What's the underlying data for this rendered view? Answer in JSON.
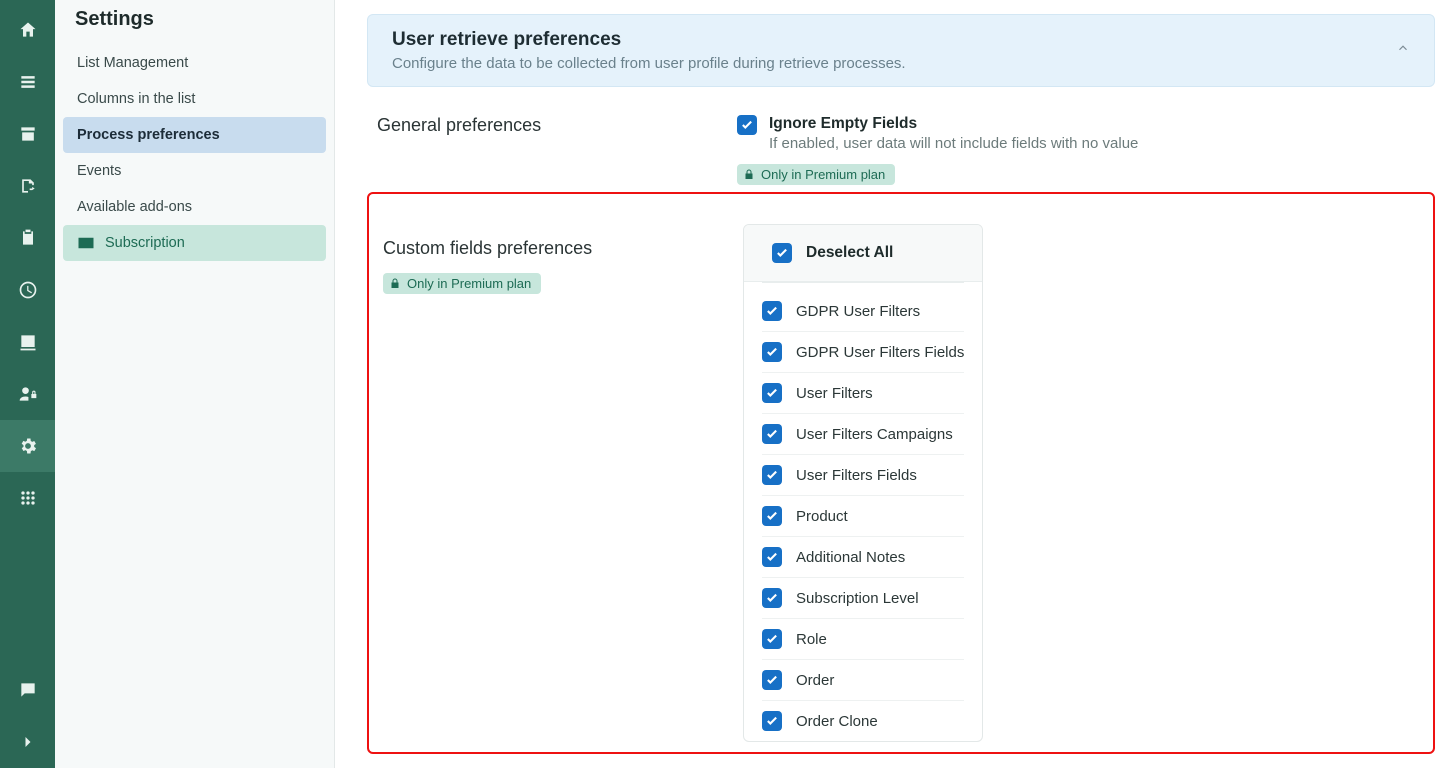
{
  "sidebar": {
    "title": "Settings",
    "items": [
      {
        "label": "List Management"
      },
      {
        "label": "Columns in the list"
      },
      {
        "label": "Process preferences"
      },
      {
        "label": "Events"
      },
      {
        "label": "Available add-ons"
      },
      {
        "label": "Subscription"
      }
    ]
  },
  "panel": {
    "title": "User retrieve preferences",
    "subtitle": "Configure the data to be collected from user profile during retrieve processes."
  },
  "general": {
    "heading": "General preferences",
    "ignore_title": "Ignore Empty Fields",
    "ignore_subtitle": "If enabled, user data will not include fields with no value"
  },
  "premium_badge": "Only in Premium plan",
  "custom": {
    "heading": "Custom fields preferences",
    "deselect_all": "Deselect All",
    "fields": [
      "GDPR User Filters",
      "GDPR User Filters Fields",
      "User Filters",
      "User Filters Campaigns",
      "User Filters Fields",
      "Product",
      "Additional Notes",
      "Subscription Level",
      "Role",
      "Order",
      "Order Clone"
    ]
  }
}
